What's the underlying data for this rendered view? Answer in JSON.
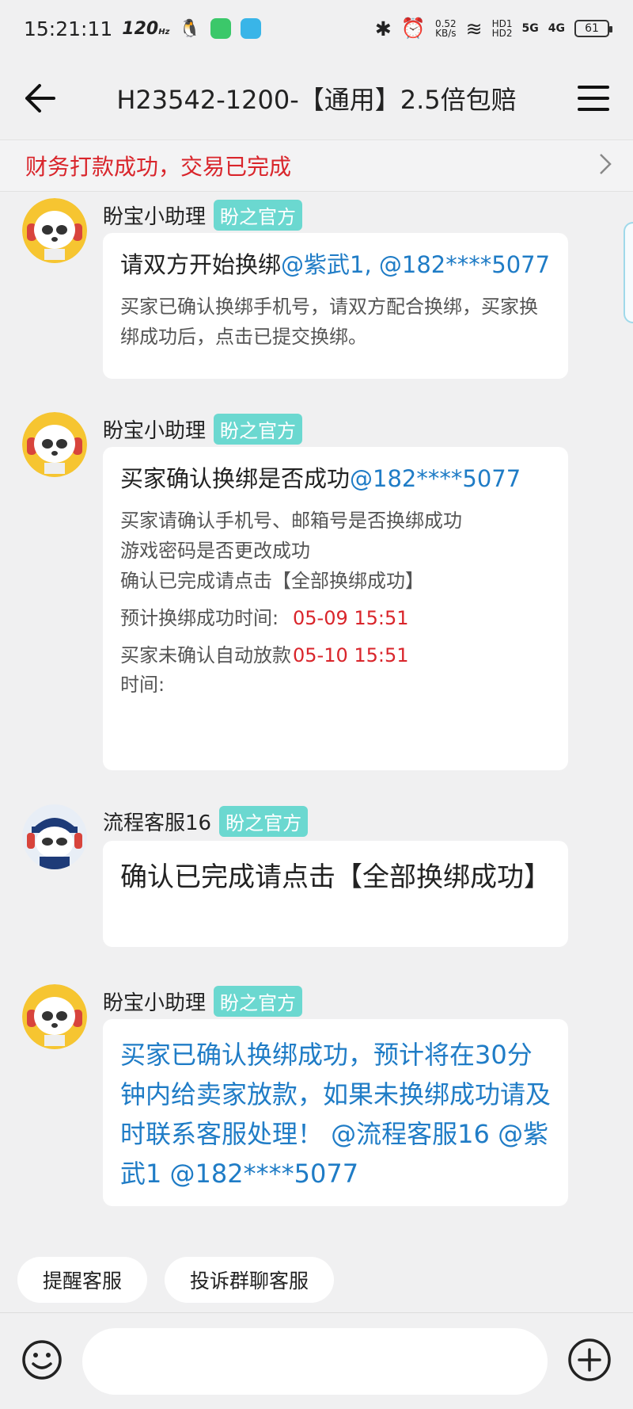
{
  "status_bar": {
    "time": "15:21:11",
    "refresh_rate": "120",
    "refresh_unit": "Hz",
    "net_speed_value": "0.52",
    "net_speed_unit": "KB/s",
    "hd1": "HD1",
    "hd2": "HD2",
    "sig1": "5G",
    "sig2": "4G",
    "battery": "61"
  },
  "header": {
    "title": "H23542-1200-【通用】2.5倍包赔"
  },
  "notice": {
    "text": "财务打款成功，交易已完成"
  },
  "messages": [
    {
      "sender": "盼宝小助理",
      "tag": "盼之官方",
      "title_text": "请双方开始换绑",
      "title_mentions": "@紫武1, @182****5077",
      "desc": "买家已确认换绑手机号，请双方配合换绑，买家换绑成功后，点击已提交换绑。"
    },
    {
      "sender": "盼宝小助理",
      "tag": "盼之官方",
      "title_text": "买家确认换绑是否成功",
      "title_mentions": "@182****5077",
      "desc_lines": [
        "买家请确认手机号、邮箱号是否换绑成功",
        "游戏密码是否更改成功",
        "确认已完成请点击【全部换绑成功】"
      ],
      "fields": [
        {
          "label": "预计换绑成功时间:",
          "value": "05-09 15:51"
        },
        {
          "label": "买家未确认自动放款时间:",
          "value": "05-10 15:51"
        }
      ]
    },
    {
      "sender": "流程客服16",
      "tag": "盼之官方",
      "text": "确认已完成请点击【全部换绑成功】"
    },
    {
      "sender": "盼宝小助理",
      "tag": "盼之官方",
      "text": "买家已确认换绑成功，预计将在30分钟内给卖家放款，如果未换绑成功请及时联系客服处理！ @流程客服16 @紫武1 @182****5077"
    }
  ],
  "quick_buttons": [
    "提醒客服",
    "投诉群聊客服"
  ],
  "colors": {
    "accent_blue": "#1f7cc6",
    "alert_red": "#d9252b",
    "tag_teal": "#6bd8d0"
  },
  "icons": {
    "back": "back-arrow-icon",
    "menu": "hamburger-menu-icon",
    "chevron": "chevron-right-icon",
    "emoji": "emoji-icon",
    "plus": "plus-circle-icon"
  }
}
